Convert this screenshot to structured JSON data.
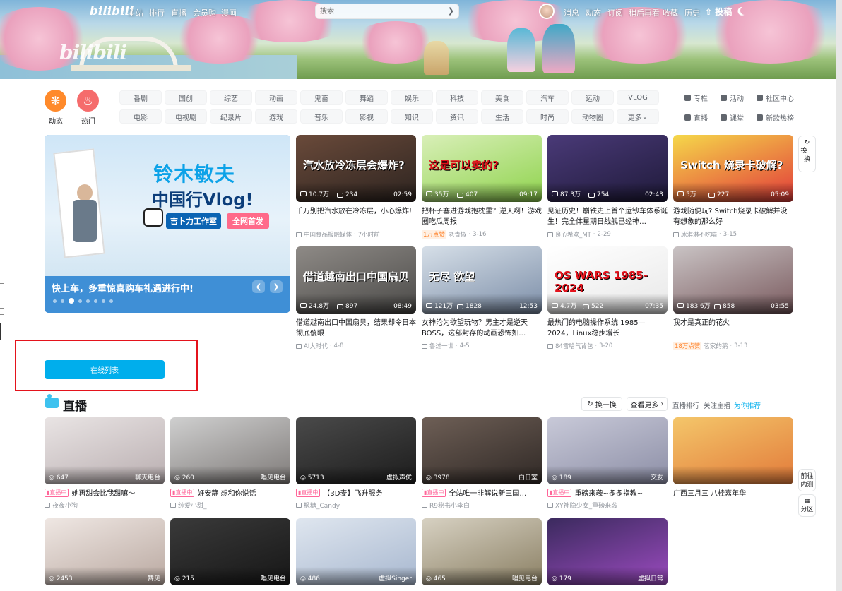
{
  "nav": {
    "logo": "bilibili",
    "left_links": [
      "主站",
      "排行",
      "直播",
      "会员购",
      "漫画"
    ],
    "search_placeholder": "搜索",
    "right_links": [
      "消息",
      "动态",
      "订阅",
      "稍后再看",
      "收藏",
      "历史"
    ],
    "upload": "投稿"
  },
  "banner": {
    "logo": "bilibili"
  },
  "channels": {
    "dynamic": "动态",
    "hot": "热门",
    "row1": [
      "番剧",
      "国创",
      "综艺",
      "动画",
      "鬼畜",
      "舞蹈",
      "娱乐",
      "科技",
      "美食",
      "汽车",
      "运动",
      "VLOG"
    ],
    "row2": [
      "电影",
      "电视剧",
      "纪录片",
      "游戏",
      "音乐",
      "影视",
      "知识",
      "资讯",
      "生活",
      "时尚",
      "动物圈",
      "更多"
    ],
    "right": [
      "专栏",
      "活动",
      "社区中心",
      "直播",
      "课堂",
      "新歌热榜"
    ]
  },
  "carousel": {
    "caption": "快上车，多重惊喜购车礼遇进行中!",
    "title1": "铃木敏夫",
    "title2": "中国行Vlog!",
    "tag1": "吉卜力工作室",
    "tag2": "全网首发",
    "dots": 8,
    "active_dot": 3
  },
  "videos": [
    {
      "views": "10.7万",
      "danmaku": "234",
      "duration": "02:59",
      "title": "千万别把汽水放在冷冻层，小心爆炸!",
      "up": "中国食品报融媒体",
      "date": "7小时前",
      "thumb_text": "汽水放冷冻层会爆炸?",
      "colors": [
        "#6a4a3a",
        "#2d2420"
      ]
    },
    {
      "views": "35万",
      "danmaku": "407",
      "duration": "09:17",
      "title": "把杯子塞进游戏抱枕里？逆天啊！游戏圈吃瓜周报",
      "badge": "1万点赞",
      "up": "老青椒",
      "date": "3-16",
      "thumb_text": "这是可以卖的?",
      "colors": [
        "#d9efb8",
        "#8fd34d"
      ]
    },
    {
      "views": "87.3万",
      "danmaku": "754",
      "duration": "02:43",
      "title": "见证历史！崩铁史上首个运钞车体系诞生！完全体星期日战舰已经神…",
      "up": "良心希欢_MT",
      "date": "2-29",
      "thumb_text": "",
      "colors": [
        "#4a3a78",
        "#1f1a3a"
      ]
    },
    {
      "views": "5万",
      "danmaku": "227",
      "duration": "05:09",
      "title": "游戏随便玩? Switch烧录卡破解并没有想象的那么好",
      "up": "冰淇淋不吃喵",
      "date": "3-15",
      "thumb_text": "Switch 烧录卡破解?",
      "colors": [
        "#f5d84a",
        "#e23a3a"
      ]
    },
    {
      "views": "24.8万",
      "danmaku": "897",
      "duration": "08:49",
      "title": "借道越南出口中国扇贝，结果却令日本彻底傻眼",
      "up": "AI大时代",
      "date": "4-8",
      "thumb_text": "借道越南出口中国扇贝",
      "colors": [
        "#8e8a86",
        "#4b4a48"
      ]
    },
    {
      "views": "121万",
      "danmaku": "1828",
      "duration": "12:53",
      "title": "女神沦为欲望玩物？男主才是逆天BOSS，这部封存的动画恐怖如…",
      "up": "鲁过一世",
      "date": "4-5",
      "thumb_text": "无尽 欲望",
      "colors": [
        "#d6dfe8",
        "#7c8ea8"
      ]
    },
    {
      "views": "4.7万",
      "danmaku": "522",
      "duration": "07:35",
      "title": "最热门的电脑操作系统 1985—2024，Linux稳步增长",
      "up": "84雷哈气背包",
      "date": "3-20",
      "thumb_text": "OS WARS 1985-2024",
      "colors": [
        "#ffffff",
        "#e8e8e8"
      ]
    },
    {
      "views": "183.6万",
      "danmaku": "858",
      "duration": "03:55",
      "title": "我才是真正的花火",
      "badge": "18万点赞",
      "up": "茗家的鹅",
      "date": "3-13",
      "thumb_text": "",
      "colors": [
        "#c9c3c4",
        "#7a5a5e"
      ]
    }
  ],
  "side": {
    "refresh": "换一换",
    "goto": "前往内测",
    "partition": "分区"
  },
  "online_list": "在线列表",
  "live": {
    "title": "直播",
    "refresh": "换一换",
    "more": "查看更多",
    "tabs": [
      "直播排行",
      "关注主播",
      "为你推荐"
    ],
    "active_tab": 2,
    "rooms": [
      {
        "viewers": "647",
        "category": "聊天电台",
        "title": "她再甜会比我甜嘛～",
        "up": "夜夜小狗",
        "colors": [
          "#e9e4e4",
          "#b9aeb0"
        ]
      },
      {
        "viewers": "260",
        "category": "唱见电台",
        "title": "好安静 想和你说话",
        "up": "纯爱小甜_",
        "colors": [
          "#cfcfcf",
          "#7e7a78"
        ]
      },
      {
        "viewers": "5713",
        "category": "虚拟声优",
        "title": "【3D麦】飞升服务",
        "up": "枫糖_Candy",
        "colors": [
          "#4a4a4a",
          "#1c1c1c"
        ]
      },
      {
        "viewers": "3978",
        "category": "白日室",
        "title": "全站唯一非解说新三国…",
        "up": "R9秘书小李白",
        "colors": [
          "#6e5f56",
          "#2f2825"
        ]
      },
      {
        "viewers": "189",
        "category": "交友",
        "title": "重磅来袭~多多指教~",
        "up": "XY神隐少女_重磅来袭",
        "colors": [
          "#c8c9d8",
          "#8c8ea6"
        ]
      },
      {
        "viewers": "",
        "category": "",
        "title": "广西三月三 八桂嘉年华",
        "up": "",
        "colors": [
          "#f4c66a",
          "#e27a3a"
        ]
      },
      {
        "viewers": "2453",
        "category": "舞见",
        "title": "",
        "up": "",
        "colors": [
          "#efe7e3",
          "#b9a8a0"
        ]
      },
      {
        "viewers": "215",
        "category": "唱见电台",
        "title": "",
        "up": "",
        "colors": [
          "#3a3a3a",
          "#161616"
        ]
      },
      {
        "viewers": "486",
        "category": "虚拟Singer",
        "title": "",
        "up": "",
        "colors": [
          "#dfe6ef",
          "#a7b7cf"
        ]
      },
      {
        "viewers": "465",
        "category": "唱见电台",
        "title": "",
        "up": "",
        "colors": [
          "#d7d1c2",
          "#8a7f63"
        ]
      },
      {
        "viewers": "179",
        "category": "虚拟日常",
        "title": "",
        "up": "",
        "colors": [
          "#3b2a5e",
          "#9b4bbf"
        ]
      }
    ]
  },
  "colors": {
    "accent": "#00aeec",
    "pink": "#ff6699",
    "orange": "#ff7f24",
    "dynamic": "#ff8a2b",
    "hot": "#f56c6c"
  }
}
